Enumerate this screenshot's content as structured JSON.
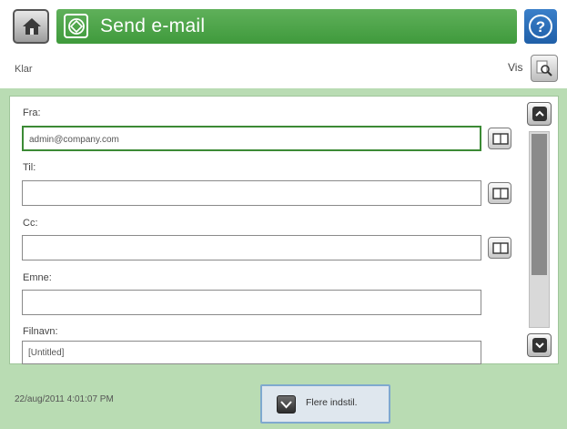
{
  "header": {
    "title": "Send e-mail",
    "home_icon": "home-icon",
    "send_icon": "send-email-icon",
    "help_symbol": "?"
  },
  "status": {
    "text": "Klar",
    "view_label": "Vis"
  },
  "form": {
    "from": {
      "label": "Fra:",
      "value": "admin@company.com"
    },
    "to": {
      "label": "Til:",
      "value": ""
    },
    "cc": {
      "label": "Cc:",
      "value": ""
    },
    "subject": {
      "label": "Emne:",
      "value": ""
    },
    "filename": {
      "label": "Filnavn:",
      "value": "[Untitled]"
    }
  },
  "footer": {
    "datetime": "22/aug/2011 4:01:07 PM",
    "more_options": "Flere indstil."
  },
  "colors": {
    "title_green": "#4aa446",
    "frame_green": "#b9dcb3",
    "help_blue": "#2a6fb8",
    "active_border": "#3c8a35"
  }
}
